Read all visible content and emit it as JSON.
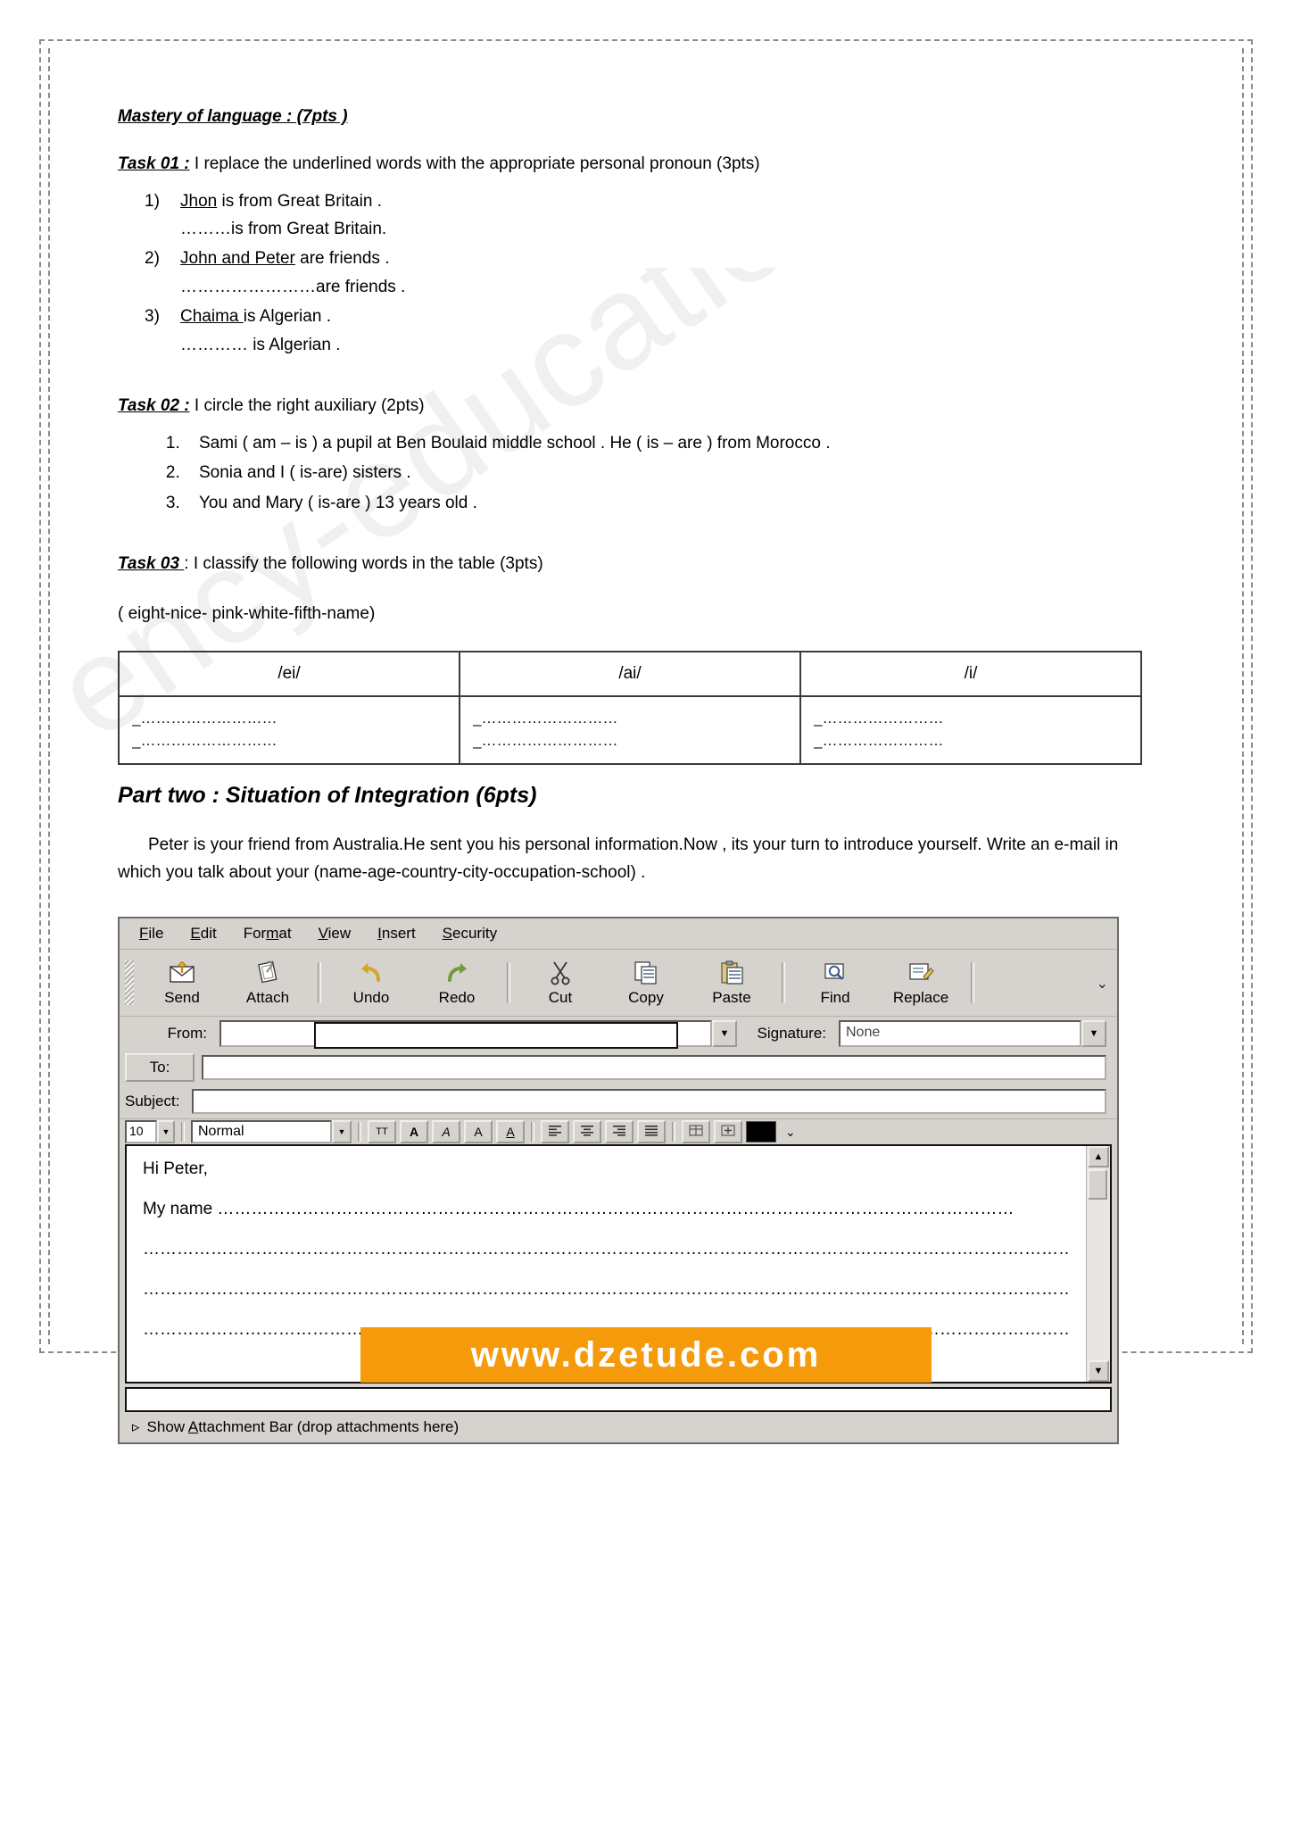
{
  "watermark": "ency-education.com/exams",
  "section_title": "Mastery of language : (7pts )",
  "task01": {
    "label": "Task 01 :",
    "instruction": " I replace the underlined words with the appropriate  personal pronoun (3pts)",
    "items": [
      {
        "num": "1)",
        "underlined": "Jhon",
        "rest": " is from Great Britain .",
        "answer": "………is from Great Britain."
      },
      {
        "num": "2)",
        "underlined": "John and Peter",
        "rest": " are friends .",
        "answer": "……………………are friends ."
      },
      {
        "num": "3)",
        "underlined": "Chaima ",
        "rest": "is Algerian .",
        "answer": "…………  is Algerian ."
      }
    ]
  },
  "task02": {
    "label": "Task 02 :",
    "instruction": " I circle the right auxiliary (2pts)",
    "items": [
      "Sami ( am – is ) a pupil at Ben Boulaid middle school . He ( is – are ) from  Morocco .",
      "Sonia and I ( is-are) sisters .",
      "You and Mary ( is-are ) 13 years old ."
    ]
  },
  "task03": {
    "label": "Task 03 ",
    "instruction": ": I classify the following words in the table (3pts)",
    "wordbank": "( eight-nice- pink-white-fifth-name)",
    "table": {
      "headers": [
        "/ei/",
        "/ai/",
        "/i/"
      ],
      "rows": [
        [
          "_………………………",
          "_………………………",
          "_……………………"
        ],
        [
          "_………………………",
          "_………………………",
          "_……………………"
        ]
      ]
    }
  },
  "part_two": {
    "title": "Part two :  Situation of Integration (6pts)",
    "paragraph": "Peter is your friend from Australia.He sent you his personal information.Now , its your turn to introduce yourself.  Write an e-mail in which you talk about your  (name-age-country-city-occupation-school) ."
  },
  "mail": {
    "menu": [
      {
        "pre": "",
        "hot": "F",
        "post": "ile"
      },
      {
        "pre": "",
        "hot": "E",
        "post": "dit"
      },
      {
        "pre": "For",
        "hot": "m",
        "post": "at"
      },
      {
        "pre": "",
        "hot": "V",
        "post": "iew"
      },
      {
        "pre": "",
        "hot": "I",
        "post": "nsert"
      },
      {
        "pre": "",
        "hot": "S",
        "post": "ecurity"
      }
    ],
    "toolbar": [
      {
        "label": "Send",
        "icon": "send-envelope-icon"
      },
      {
        "label": "Attach",
        "icon": "attach-paperclip-icon"
      },
      {
        "label": "Undo",
        "icon": "undo-arrow-icon"
      },
      {
        "label": "Redo",
        "icon": "redo-arrow-icon"
      },
      {
        "label": "Cut",
        "icon": "scissors-icon"
      },
      {
        "label": "Copy",
        "icon": "copy-icon"
      },
      {
        "label": "Paste",
        "icon": "clipboard-paste-icon"
      },
      {
        "label": "Find",
        "icon": "magnifier-icon"
      },
      {
        "label": "Replace",
        "icon": "replace-icon"
      }
    ],
    "toolbar_overflow": "⌄",
    "fields": {
      "from_label": "From:",
      "from_value": "",
      "signature_label": "Signature:",
      "signature_value": "None",
      "to_label": "To:",
      "to_value": "",
      "subject_label": "Subject:",
      "subject_value": ""
    },
    "format": {
      "size_value": "10",
      "style_value": "Normal",
      "buttons": [
        "TT",
        "A",
        "A",
        "A",
        "A"
      ],
      "align_buttons": [
        "align-left",
        "align-center",
        "align-right",
        "align-justify"
      ],
      "extra_buttons": [
        "table",
        "insert",
        "color"
      ]
    },
    "body_lines": [
      "Hi Peter,",
      "My name ……………………………………………………………………………………………………………………………",
      "……………………………………………………………………………………………………………………………………………………",
      "……………………………………………………………………………………………………………………………………………………",
      "……………………………………………………………………………………………………………………………………………………"
    ],
    "attachment_bar": {
      "arrow": "▹",
      "pre": "Show ",
      "hot": "A",
      "post": "ttachment Bar (drop attachments here)"
    }
  },
  "footer": {
    "text": "www.dzetude.com",
    "bg": "#f59b0b",
    "color": "#ffffff"
  }
}
